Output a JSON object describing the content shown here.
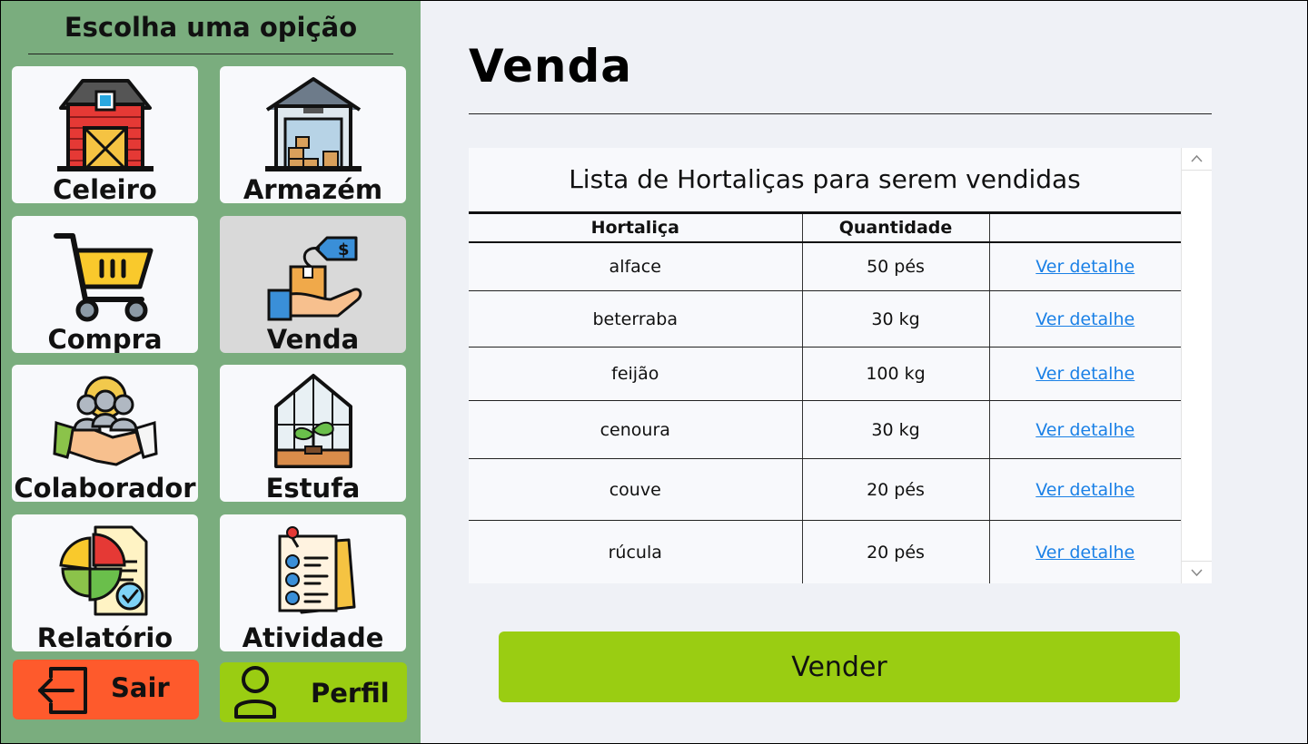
{
  "sidebar": {
    "title": "Escolha uma opição",
    "tiles": [
      {
        "label": "Celeiro",
        "icon": "barn-icon"
      },
      {
        "label": "Armazém",
        "icon": "warehouse-icon"
      },
      {
        "label": "Compra",
        "icon": "shopping-cart-icon"
      },
      {
        "label": "Venda",
        "icon": "sale-hand-box-icon"
      },
      {
        "label": "Colaborador",
        "icon": "handshake-team-icon"
      },
      {
        "label": "Estufa",
        "icon": "greenhouse-icon"
      },
      {
        "label": "Relatório",
        "icon": "report-pie-chart-icon"
      },
      {
        "label": "Atividade",
        "icon": "checklist-icon"
      }
    ],
    "active_tile": "Venda",
    "logout_label": "Sair",
    "profile_label": "Perfil"
  },
  "main": {
    "title": "Venda",
    "list_title": "Lista de Hortaliças para serem vendidas",
    "columns": [
      "Hortaliça",
      "Quantidade",
      ""
    ],
    "rows": [
      {
        "name": "alface",
        "quantity": "50 pés",
        "action": "Ver detalhe"
      },
      {
        "name": "beterraba",
        "quantity": "30 kg",
        "action": "Ver detalhe"
      },
      {
        "name": "feijão",
        "quantity": "100 kg",
        "action": "Ver detalhe"
      },
      {
        "name": "cenoura",
        "quantity": "30 kg",
        "action": "Ver detalhe"
      },
      {
        "name": "couve",
        "quantity": "20 pés",
        "action": "Ver detalhe"
      },
      {
        "name": "rúcula",
        "quantity": "20 pés",
        "action": "Ver detalhe"
      }
    ],
    "sell_button": "Vender"
  },
  "colors": {
    "sidebar_bg": "#7aad7e",
    "tile_bg": "#f8f9fc",
    "active_tile_bg": "#d9d9d9",
    "logout_bg": "#fe5a2c",
    "accent_green": "#9acd12",
    "link": "#1a80e6",
    "page_bg": "#eff1f6"
  }
}
